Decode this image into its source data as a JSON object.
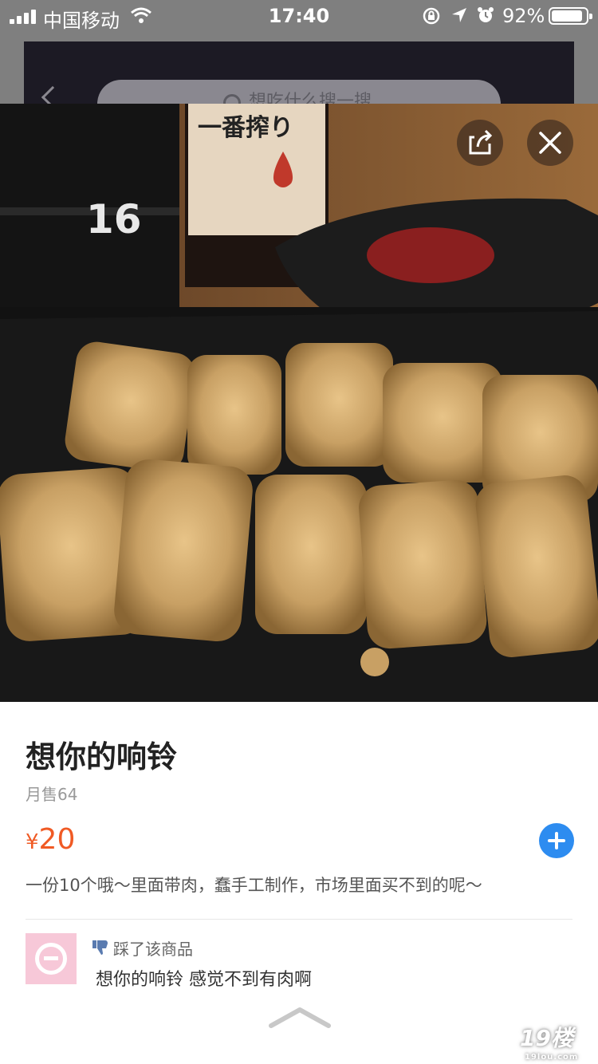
{
  "status_bar": {
    "carrier": "中国移动",
    "time": "17:40",
    "battery_percent": "92%",
    "icons": [
      "signal-icon",
      "wifi-icon",
      "rotation-lock-icon",
      "location-icon",
      "alarm-icon",
      "battery-icon"
    ]
  },
  "background_page": {
    "search_placeholder": "想吃什么搜一搜",
    "more_label": "•••"
  },
  "overlay": {
    "share_icon": "share-icon",
    "close_icon": "close-icon"
  },
  "item": {
    "title": "想你的响铃",
    "monthly_sales": "月售64",
    "price_symbol": "¥",
    "price": "20",
    "description": "一份10个哦～里面带肉，蠢手工制作，市场里面买不到的呢～",
    "add_icon": "plus-circle-icon"
  },
  "review": {
    "action": "踩了该商品",
    "text": "想你的响铃 感觉不到有肉啊",
    "icon": "thumbs-down-icon"
  },
  "watermark": {
    "main": "19楼",
    "sub": "19lou.com"
  },
  "colors": {
    "price": "#f05a24",
    "add_button": "#2d8cf0",
    "avatar_bg": "#f7c8d8"
  }
}
